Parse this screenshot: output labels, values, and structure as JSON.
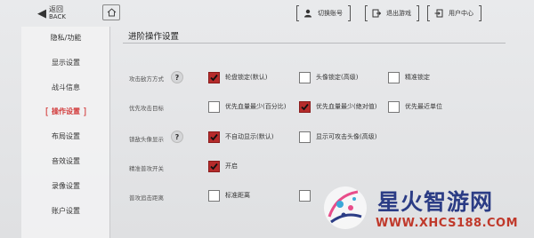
{
  "topbar": {
    "back_cn": "返回",
    "back_en": "BACK",
    "switch_account": "切换账号",
    "exit_game": "退出游戏",
    "user_center": "用户中心"
  },
  "sidebar": {
    "items": [
      {
        "label": "隐私/功能"
      },
      {
        "label": "显示设置"
      },
      {
        "label": "战斗信息"
      },
      {
        "label": "操作设置",
        "active": true
      },
      {
        "label": "布局设置"
      },
      {
        "label": "音效设置"
      },
      {
        "label": "录像设置"
      },
      {
        "label": "账户设置"
      }
    ]
  },
  "main": {
    "title": "进阶操作设置",
    "rows": [
      {
        "label": "攻击敌方方式",
        "help": "?",
        "options": [
          {
            "label": "轮盘锁定(默认)",
            "checked": true
          },
          {
            "label": "头像锁定(高级)",
            "checked": false
          },
          {
            "label": "精准锁定",
            "checked": false
          }
        ]
      },
      {
        "label": "优先攻击目标",
        "options": [
          {
            "label": "优先血量最少(百分比)",
            "checked": false
          },
          {
            "label": "优先血量最少(绝对值)",
            "checked": true
          },
          {
            "label": "优先最近单位",
            "checked": false
          }
        ]
      },
      {
        "label": "锁敌头像显示",
        "help": "?",
        "options": [
          {
            "label": "不自动显示(默认)",
            "checked": true
          },
          {
            "label": "显示可攻击头像(高级)",
            "checked": false
          }
        ]
      },
      {
        "label": "精准普攻开关",
        "options": [
          {
            "label": "开启",
            "checked": true
          }
        ]
      },
      {
        "label": "普攻追击距离",
        "options": [
          {
            "label": "标准距离",
            "checked": false
          },
          {
            "label": "",
            "checked": false
          }
        ]
      }
    ]
  },
  "watermark": {
    "title": "星火智游网",
    "url": "WWW.XHCS188.COM"
  },
  "colors": {
    "accent": "#d23a3a",
    "checked": "#b52b2b",
    "brand_blue": "#2b3c85"
  }
}
